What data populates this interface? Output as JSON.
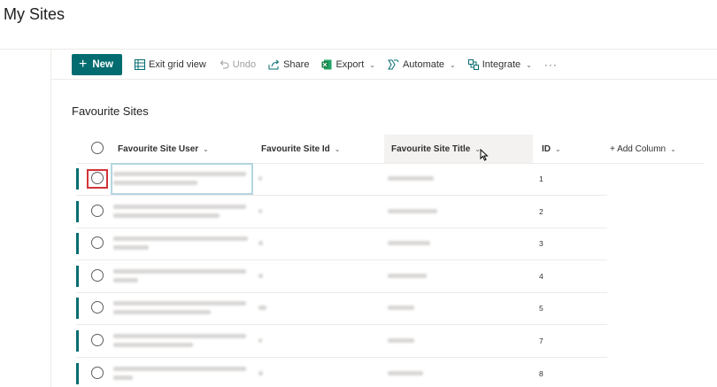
{
  "page": {
    "title": "My Sites"
  },
  "toolbar": {
    "new_label": "New",
    "exit_grid_label": "Exit grid view",
    "undo_label": "Undo",
    "share_label": "Share",
    "export_label": "Export",
    "automate_label": "Automate",
    "integrate_label": "Integrate",
    "more_label": "···"
  },
  "list": {
    "title": "Favourite Sites",
    "columns": {
      "user": "Favourite Site User",
      "site_id": "Favourite Site Id",
      "site_title": "Favourite Site Title",
      "id": "ID",
      "add": "+ Add Column"
    },
    "rows": [
      {
        "id": "1"
      },
      {
        "id": "2"
      },
      {
        "id": "3"
      },
      {
        "id": "4"
      },
      {
        "id": "5"
      },
      {
        "id": "7"
      },
      {
        "id": "8"
      }
    ]
  },
  "colors": {
    "accent": "#036c70",
    "selection_outline": "#d13438",
    "focus_cell": "#b4d6e0"
  },
  "icons": [
    "plus-icon",
    "grid-icon",
    "undo-icon",
    "share-icon",
    "excel-icon",
    "automate-icon",
    "integrate-icon",
    "chevron-down-icon",
    "cursor-icon"
  ]
}
